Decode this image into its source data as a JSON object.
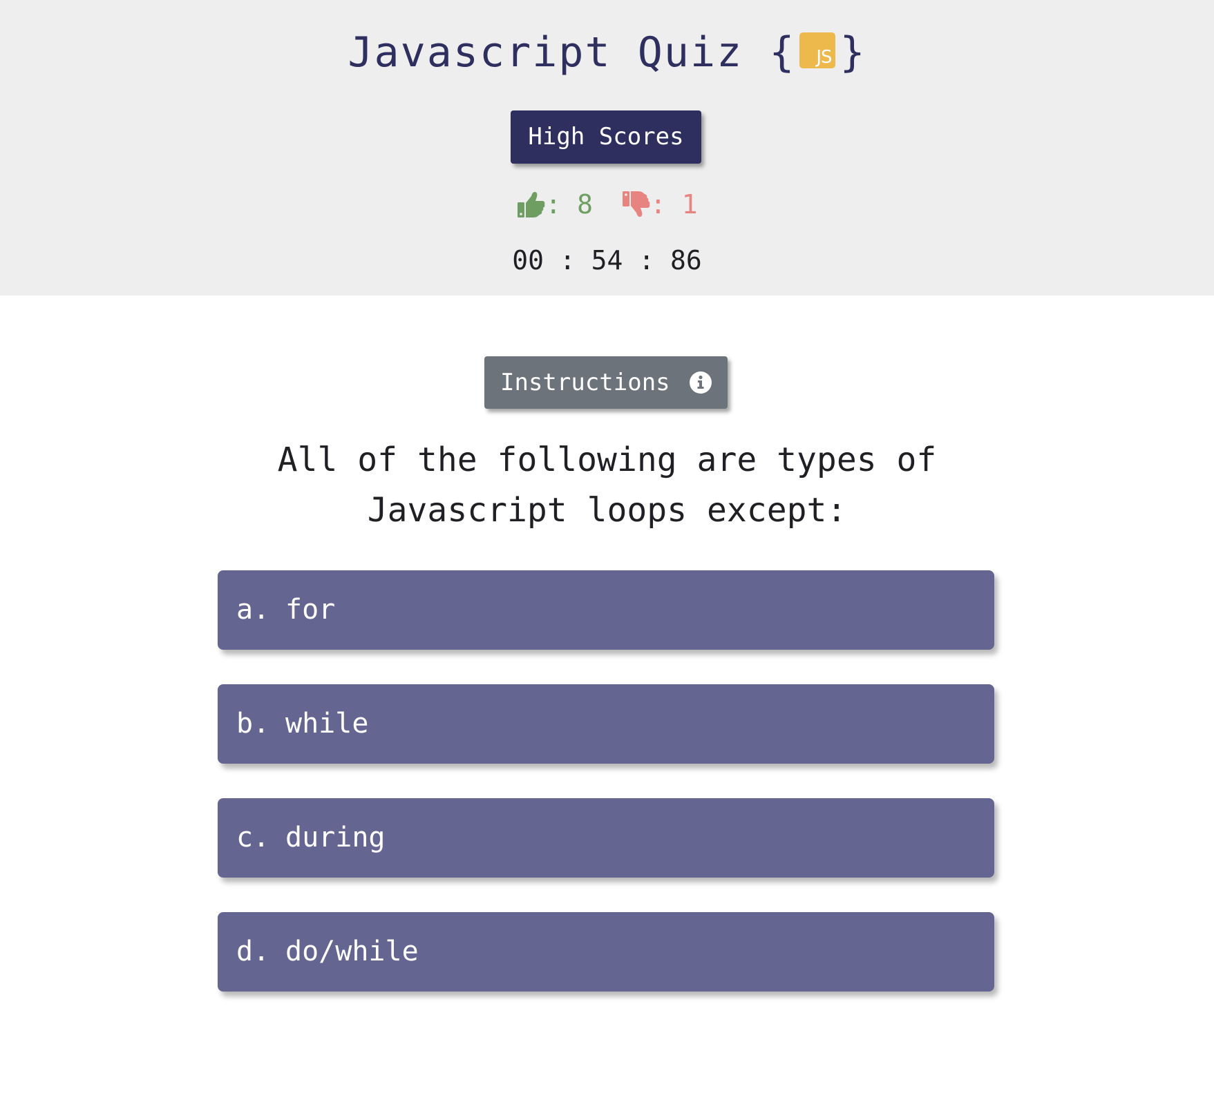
{
  "header": {
    "title": "Javascript Quiz",
    "brace_open": "{",
    "brace_close": "}",
    "logo_text": "JS",
    "high_scores_label": "High Scores"
  },
  "score": {
    "correct_icon": "thumbs-up-icon",
    "incorrect_icon": "thumbs-down-icon",
    "separator": ":",
    "correct": "8",
    "incorrect": "1"
  },
  "timer": {
    "display": "00 : 54 : 86"
  },
  "instructions": {
    "label": "Instructions",
    "icon": "info-icon"
  },
  "question": {
    "text": "All of the following are types of Javascript loops except:"
  },
  "answers": [
    {
      "letter": "a.",
      "text": "for"
    },
    {
      "letter": "b.",
      "text": "while"
    },
    {
      "letter": "c.",
      "text": "during"
    },
    {
      "letter": "d.",
      "text": "do/while"
    }
  ],
  "colors": {
    "header_bg": "#eeeeee",
    "primary": "#2e2f5e",
    "answer_bg": "#656591",
    "instructions_bg": "#6c737b",
    "correct": "#6e9e62",
    "incorrect": "#e8847f",
    "js_badge": "#eeb94c"
  }
}
